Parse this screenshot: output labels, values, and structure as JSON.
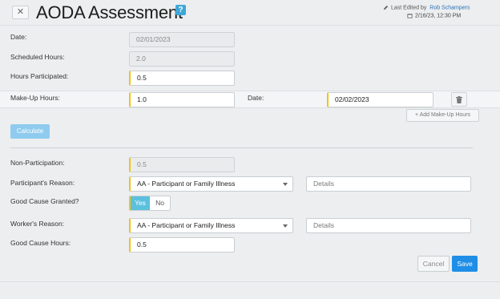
{
  "header": {
    "close_glyph": "✕",
    "title": "AODA Assessment",
    "help_glyph": "?",
    "last_edited_prefix": "Last Edited by",
    "last_edited_by": "Rob Schampers",
    "last_edited_at": "2/16/23, 12:30 PM"
  },
  "form": {
    "date_label": "Date:",
    "date_value": "02/01/2023",
    "scheduled_label": "Scheduled Hours:",
    "scheduled_value": "2.0",
    "participated_label": "Hours Participated:",
    "participated_value": "0.5",
    "makeup_label": "Make-Up Hours:",
    "makeup_value": "1.0",
    "makeup_date_label": "Date:",
    "makeup_date_value": "02/02/2023",
    "add_makeup_label": "+ Add Make-Up Hours",
    "calculate_label": "Calculate",
    "nonpart_label": "Non-Participation:",
    "nonpart_value": "0.5",
    "participant_reason_label": "Participant's Reason:",
    "participant_reason_value": "AA - Participant or Family Illness",
    "participant_details_placeholder": "Details",
    "good_cause_label": "Good Cause Granted?",
    "yes_label": "Yes",
    "no_label": "No",
    "good_cause_selected": "Yes",
    "worker_reason_label": "Worker's Reason:",
    "worker_reason_value": "AA - Participant or Family Illness",
    "worker_details_placeholder": "Details",
    "good_cause_hours_label": "Good Cause Hours:",
    "good_cause_hours_value": "0.5"
  },
  "actions": {
    "cancel_label": "Cancel",
    "save_label": "Save"
  },
  "colors": {
    "required_accent": "#f0c419",
    "primary": "#1e8ee6",
    "toggle_active": "#5bc0de",
    "help_badge": "#3fa7d6"
  }
}
